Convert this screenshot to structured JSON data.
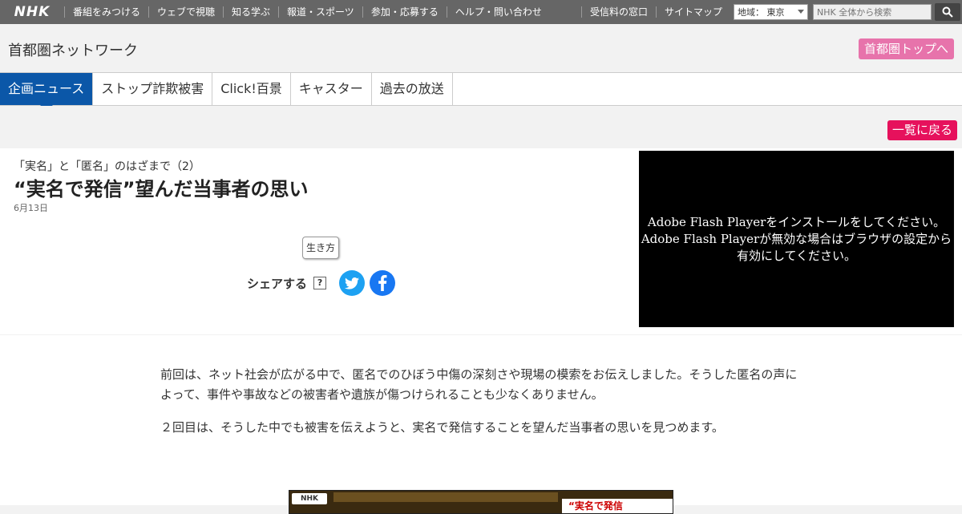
{
  "header": {
    "logo": "NHK",
    "nav": [
      "番組をみつける",
      "ウェブで視聴",
      "知る学ぶ",
      "報道・スポーツ",
      "参加・応募する",
      "ヘルプ・問い合わせ"
    ],
    "right_links": [
      "受信料の窓口",
      "サイトマップ"
    ],
    "region_label": "地域： 東京",
    "search_placeholder": "NHK 全体から検索"
  },
  "station": {
    "title": "首都圏ネットワーク",
    "top_link": "首都圏トップへ"
  },
  "tabs": [
    {
      "label": "企画ニュース",
      "active": true
    },
    {
      "label": "ストップ詐欺被害",
      "active": false
    },
    {
      "label": "Click!百景",
      "active": false
    },
    {
      "label": "キャスター",
      "active": false
    },
    {
      "label": "過去の放送",
      "active": false
    }
  ],
  "back_button": "一覧に戻る",
  "article": {
    "subtitle": "「実名」と「匿名」のはざまで（2）",
    "headline": "“実名で発信”望んだ当事者の思い",
    "date": "6月13日",
    "tag": "生き方",
    "share_label": "シェアする",
    "share_help": "?",
    "player_message_1": "Adobe Flash Playerをインストールをしてください。",
    "player_message_2": "Adobe Flash Playerが無効な場合はブラウザの設定から",
    "player_message_3": "有効にしてください。",
    "paragraph_1": "前回は、ネット社会が広がる中で、匿名でのひぼう中傷の深刻さや現場の模索をお伝えしました。そうした匿名の声によって、事件や事故などの被害者や遺族が傷つけられることも少なくありません。",
    "paragraph_2": "２回目は、そうした中でも被害を伝えようと、実名で発信することを望んだ当事者の思いを見つめます。",
    "thumb_logo": "NHK",
    "thumb_caption": "“実名で発信"
  },
  "colors": {
    "active_tab": "#0b57a8",
    "back_button": "#e6115c",
    "top_link": "#e773ab",
    "twitter": "#1da1f2",
    "facebook": "#1877f2"
  }
}
